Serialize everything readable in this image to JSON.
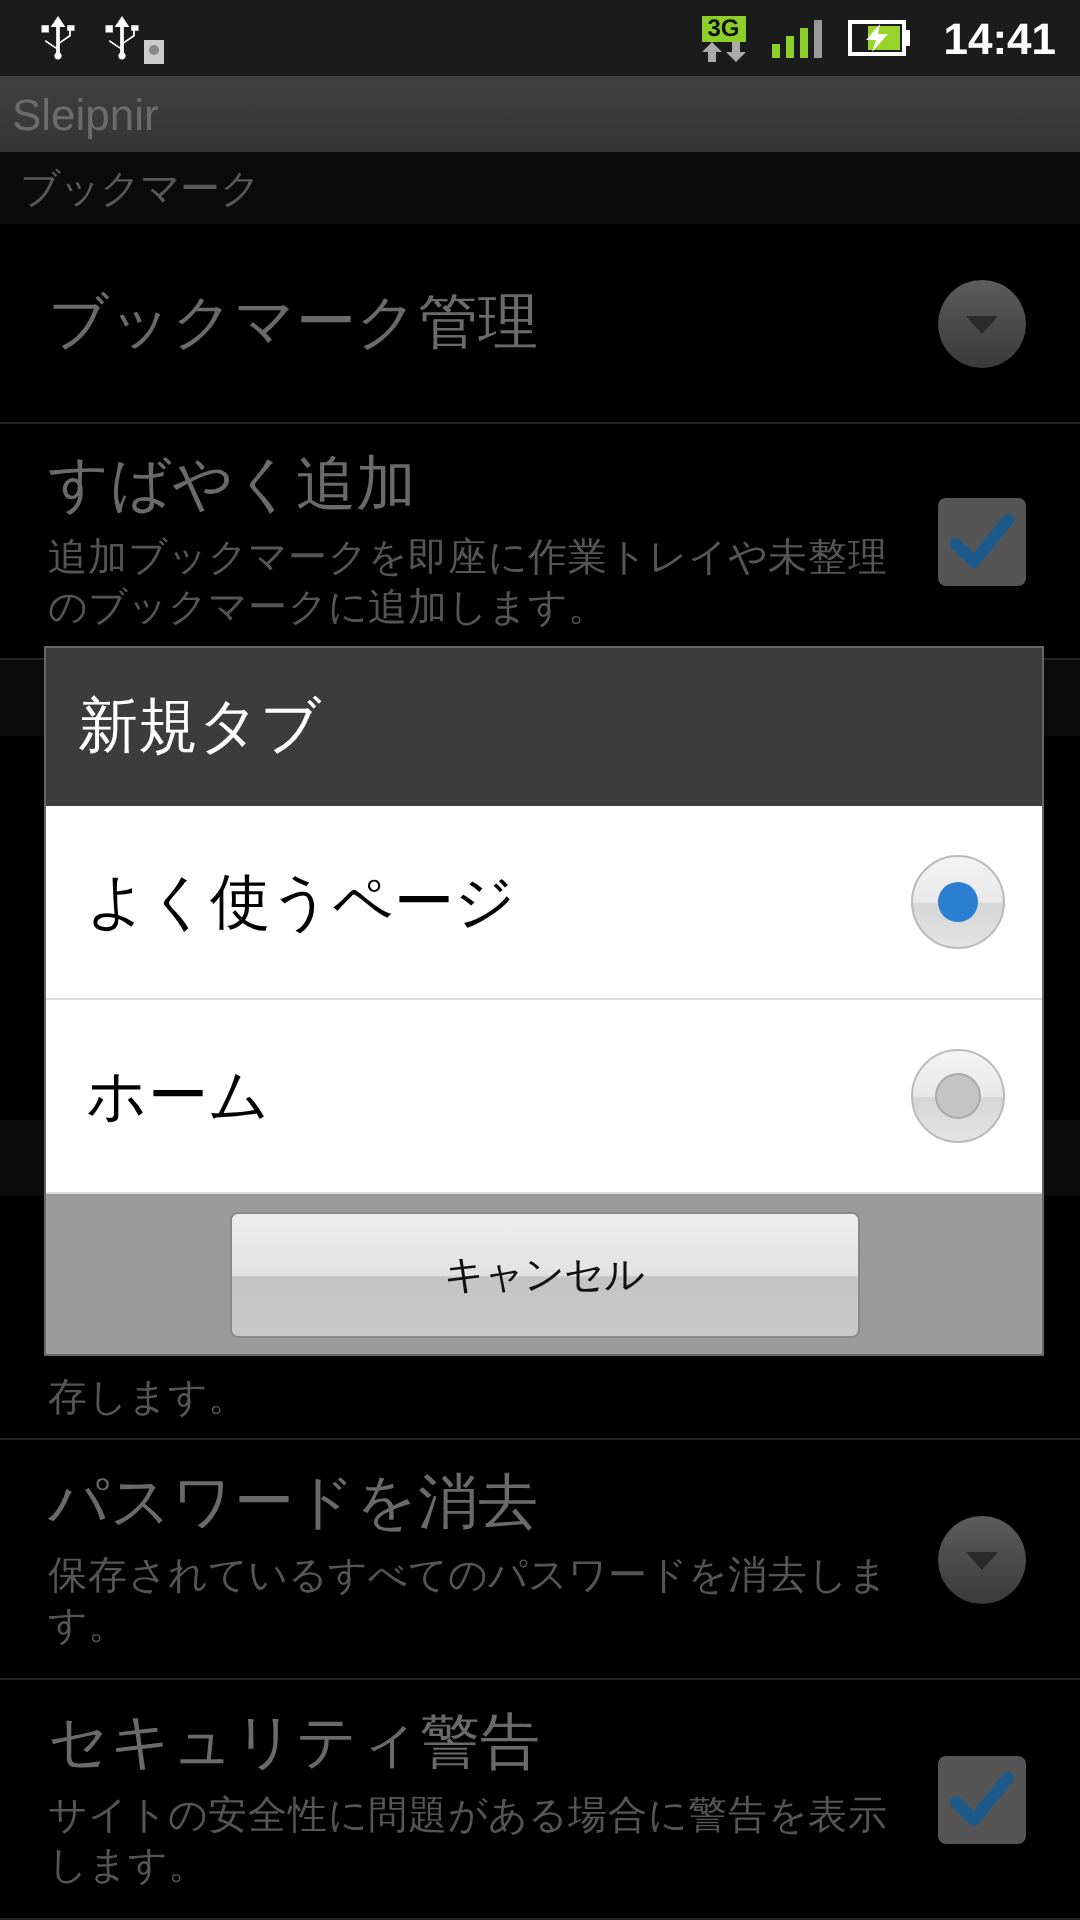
{
  "status_bar": {
    "network": "3G",
    "time": "14:41"
  },
  "app_title": "Sleipnir",
  "list": [
    {
      "kind": "header",
      "title": "ブックマーク"
    },
    {
      "kind": "dropdown",
      "title": "ブックマーク管理"
    },
    {
      "kind": "checkbox",
      "title": "すばやく追加",
      "summary": "追加ブックマークを即座に作業トレイや未整理のブックマークに追加します。",
      "checked": true
    },
    {
      "kind": "header"
    },
    {
      "kind": "blank"
    },
    {
      "kind": "header"
    },
    {
      "kind": "tail",
      "summary": "存します。"
    },
    {
      "kind": "dropdown",
      "title": "パスワードを消去",
      "summary": "保存されているすべてのパスワードを消去します。"
    },
    {
      "kind": "checkbox",
      "title": "セキュリティ警告",
      "summary": "サイトの安全性に問題がある場合に警告を表示します。",
      "checked": true
    }
  ],
  "dialog": {
    "title": "新規タブ",
    "options": [
      {
        "label": "よく使うページ",
        "selected": true
      },
      {
        "label": "ホーム",
        "selected": false
      }
    ],
    "cancel": "キャンセル"
  }
}
